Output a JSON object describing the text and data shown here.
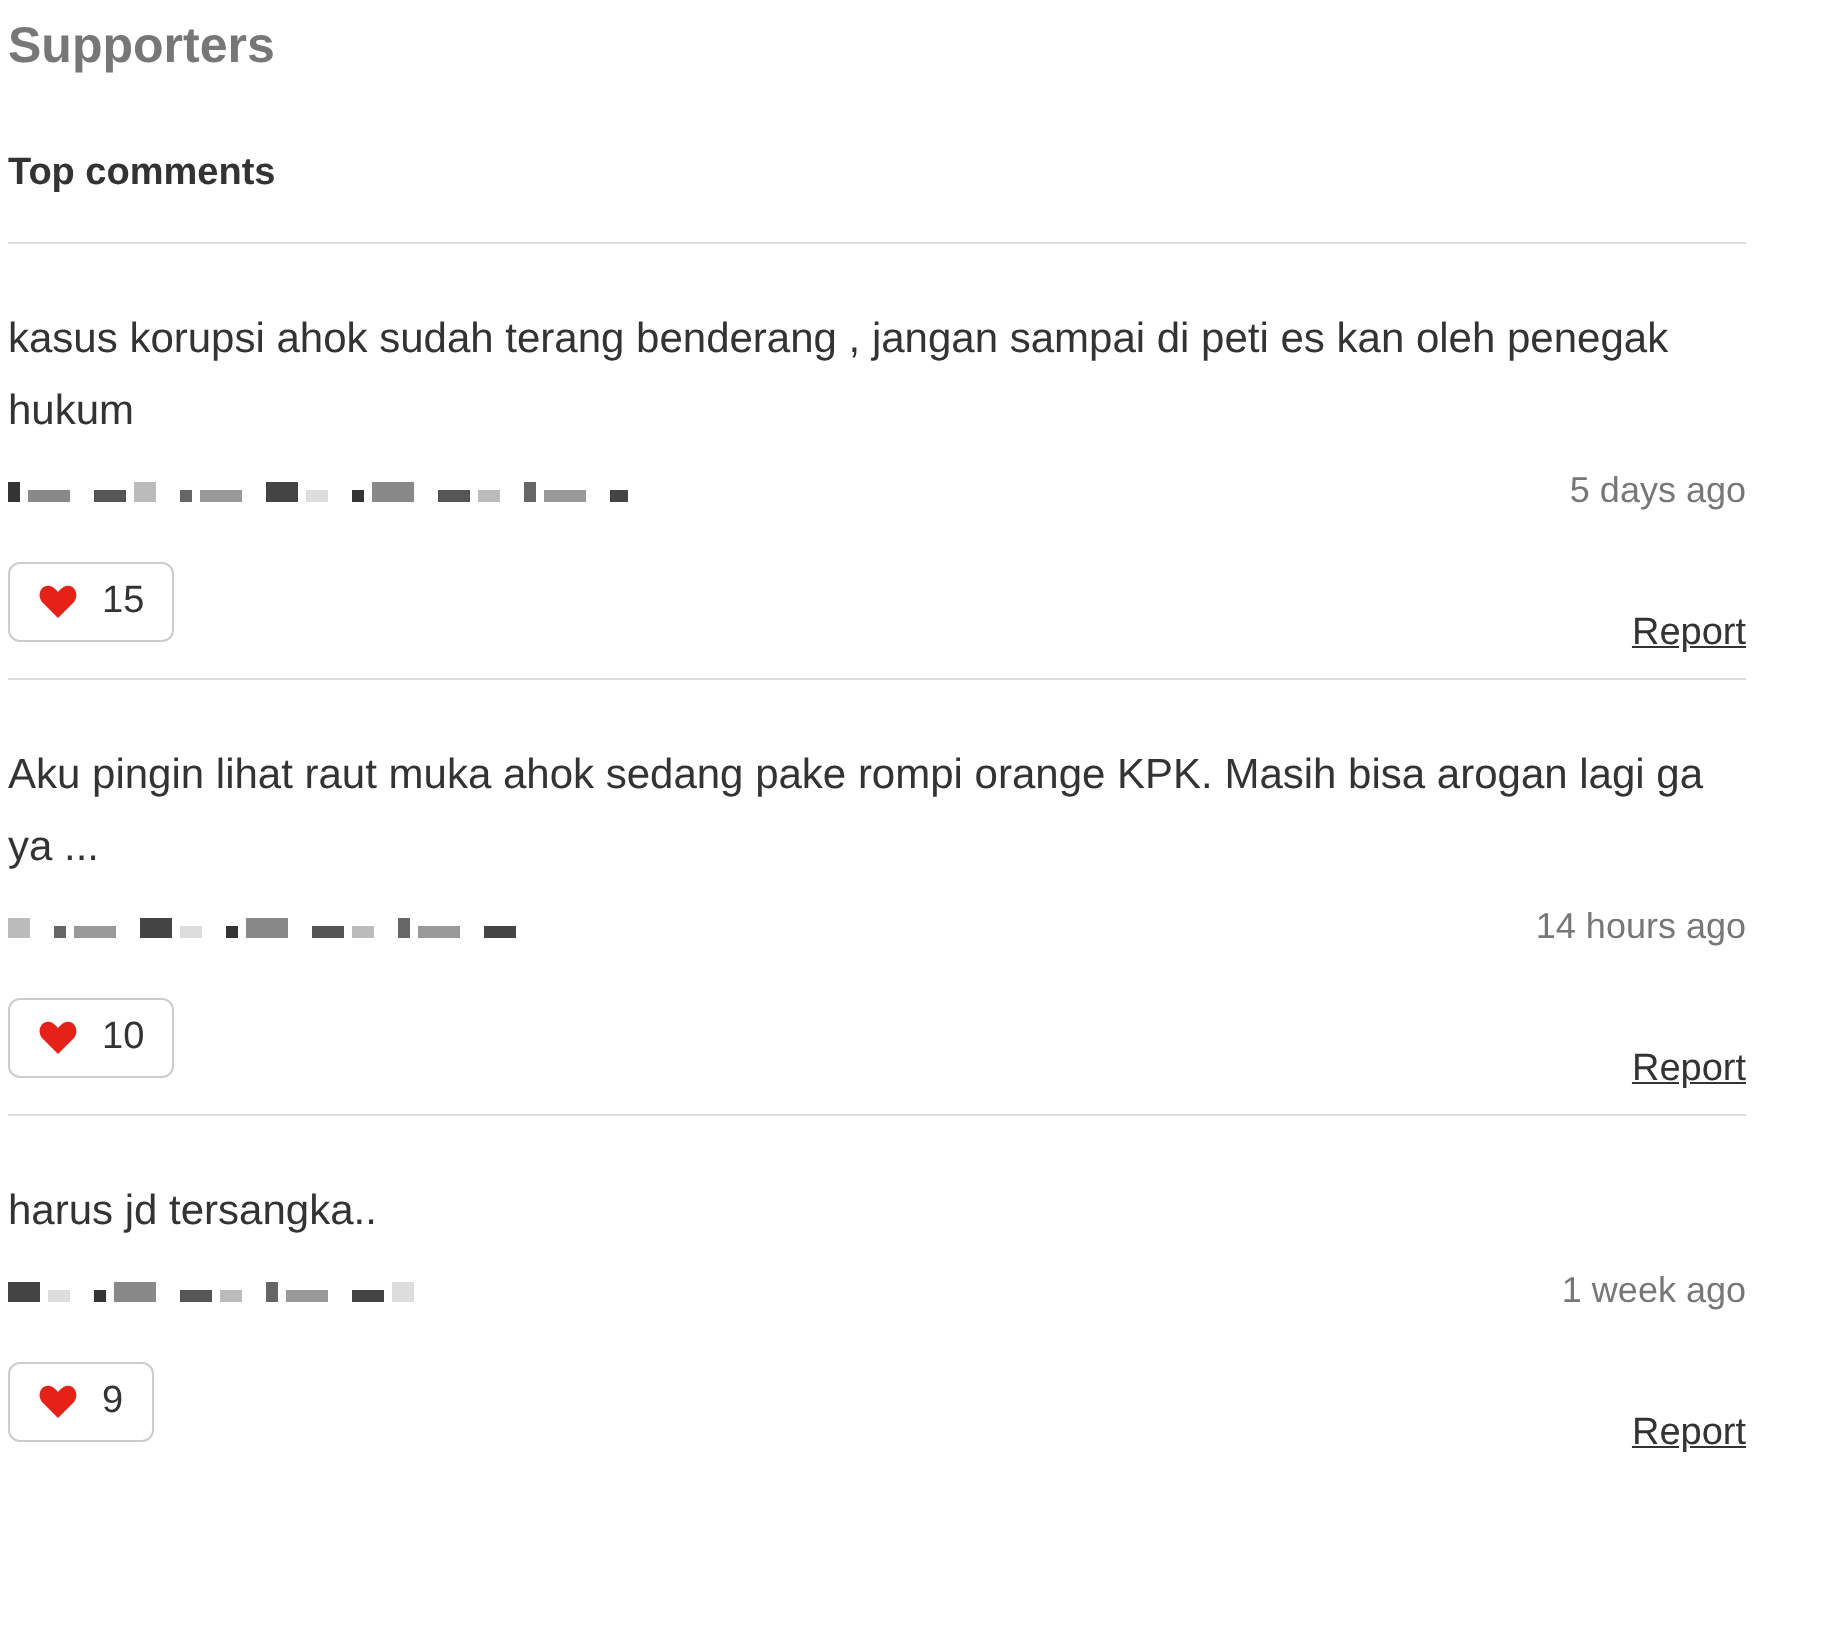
{
  "title": "Supporters",
  "section": "Top comments",
  "comments": [
    {
      "text": "kasus korupsi ahok sudah terang benderang , jangan sampai di peti es kan oleh penegak hukum",
      "time": "5 days ago",
      "likes": "15",
      "report": "Report"
    },
    {
      "text": "Aku pingin lihat raut muka ahok sedang pake rompi orange KPK. Masih bisa arogan lagi ga ya ...",
      "time": "14 hours ago",
      "likes": "10",
      "report": "Report"
    },
    {
      "text": "harus jd tersangka..",
      "time": "1 week ago",
      "likes": "9",
      "report": "Report"
    }
  ]
}
